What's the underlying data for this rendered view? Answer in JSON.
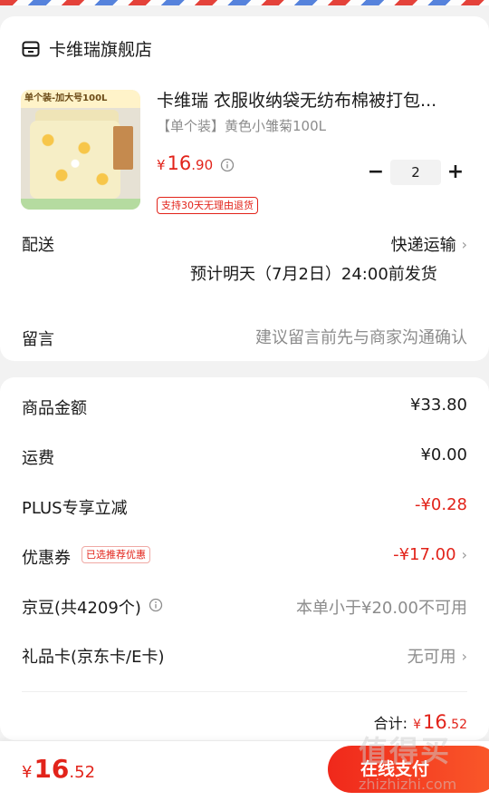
{
  "store": {
    "name": "卡维瑞旗舰店",
    "icon": "store-icon"
  },
  "product": {
    "image_tag": "单个装-加大号100L",
    "title": "卡维瑞 衣服收纳袋无纺布棉被打包...",
    "variant": "【单个装】黄色小雏菊100L",
    "price_currency": "¥",
    "price_int": "16",
    "price_dec": ".90",
    "quantity": "2",
    "minus_label": "−",
    "plus_label": "+",
    "return_badge": "支持30天无理由退货"
  },
  "delivery": {
    "label": "配送",
    "method": "快递运输",
    "estimate": "预计明天（7月2日）24:00前发货"
  },
  "message": {
    "label": "留言",
    "placeholder": "建议留言前先与商家沟通确认"
  },
  "summary": {
    "goods_label": "商品金额",
    "goods_value": "¥33.80",
    "shipping_label": "运费",
    "shipping_value": "¥0.00",
    "plus_label": "PLUS专享立减",
    "plus_value": "-¥0.28",
    "coupon_label": "优惠券",
    "coupon_tag": "已选推荐优惠",
    "coupon_value": "-¥17.00",
    "jingdou_label": "京豆(共4209个)",
    "jingdou_value": "本单小于¥20.00不可用",
    "giftcard_label": "礼品卡(京东卡/E卡)",
    "giftcard_value": "无可用",
    "total_label": "合计:",
    "total_currency": "¥",
    "total_int": "16",
    "total_dec": ".52"
  },
  "bottom": {
    "currency": "¥",
    "int": "16",
    "dec": ".52",
    "pay_label": "在线支付"
  },
  "watermark": {
    "main": "值得买",
    "sub": "zhizhizhi.com"
  },
  "colors": {
    "accent": "#e2231a",
    "muted": "#8c8c8c",
    "background": "#f2f2f2"
  }
}
